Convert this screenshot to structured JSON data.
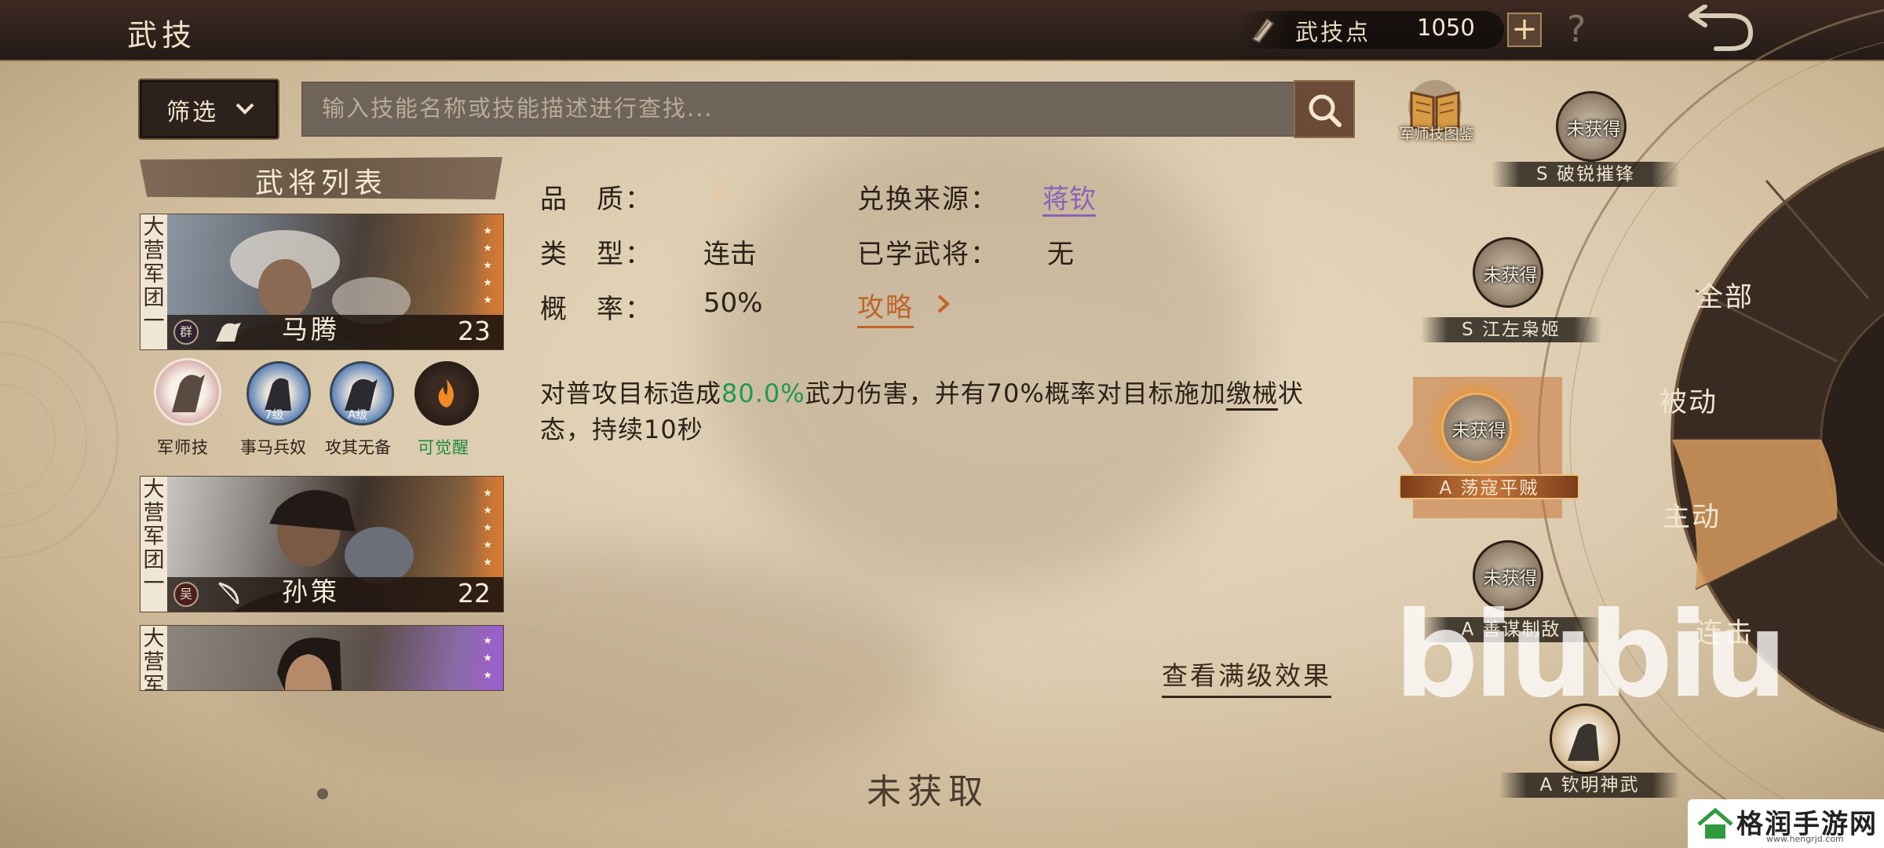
{
  "header": {
    "title": "武技",
    "points_label": "武技点",
    "points_value": "1050",
    "add_label": "+",
    "help_label": "?"
  },
  "toolbar": {
    "filter_label": "筛选",
    "search_placeholder": "输入技能名称或技能描述进行查找...",
    "codex_label": "军师技图鉴"
  },
  "general_list": {
    "title": "武将列表",
    "cards": [
      {
        "tag": "大营军团一",
        "name": "马腾",
        "level": "23",
        "faction": "群",
        "stars": 5
      },
      {
        "tag": "大营军团一",
        "name": "孙策",
        "level": "22",
        "faction": "吴",
        "stars": 5
      },
      {
        "tag": "大营军",
        "name": "",
        "level": "",
        "faction": "",
        "stars": 3
      }
    ],
    "skills": [
      {
        "label": "军师技",
        "badge": ""
      },
      {
        "label": "事马兵奴",
        "badge": "7级"
      },
      {
        "label": "攻其无备",
        "badge": "A级"
      },
      {
        "label": "可觉醒",
        "badge": ""
      }
    ]
  },
  "detail": {
    "quality_label": "品　质：",
    "quality_value": "A",
    "source_label": "兑换来源：",
    "source_value": "蒋钦",
    "type_label": "类　型：",
    "type_value": "连击",
    "learned_label": "已学武将：",
    "learned_value": "无",
    "chance_label": "概　率：",
    "chance_value": "50%",
    "guide_label": "攻略",
    "desc_part1": "对普攻目标造成",
    "desc_highlight": "80.0%",
    "desc_part2": "武力伤害，并有70%概率对目标施加",
    "desc_underline": "缴械",
    "desc_part3": "状态，持续10秒",
    "full_effect_label": "查看满级效果",
    "status": "未获取"
  },
  "wheel": {
    "nodes": [
      {
        "status": "未获得",
        "name": "S 破锐摧锋"
      },
      {
        "status": "未获得",
        "name": "S 江左枭姬"
      },
      {
        "status": "未获得",
        "name": "A 荡寇平贼"
      },
      {
        "status": "未获得",
        "name": "A 善谋制敌"
      },
      {
        "status": "",
        "name": "A 钦明神武"
      }
    ],
    "categories": [
      "全部",
      "被动",
      "主动",
      "连击"
    ]
  },
  "watermark": "biubiu",
  "site": {
    "name": "格润手游网",
    "url": "www.hengrjd.com"
  },
  "colors": {
    "highlight_green": "#1f9a4e",
    "source_purple": "#8a63b8",
    "guide_orange": "#c0642a",
    "active_wheel": "#c8773a"
  }
}
